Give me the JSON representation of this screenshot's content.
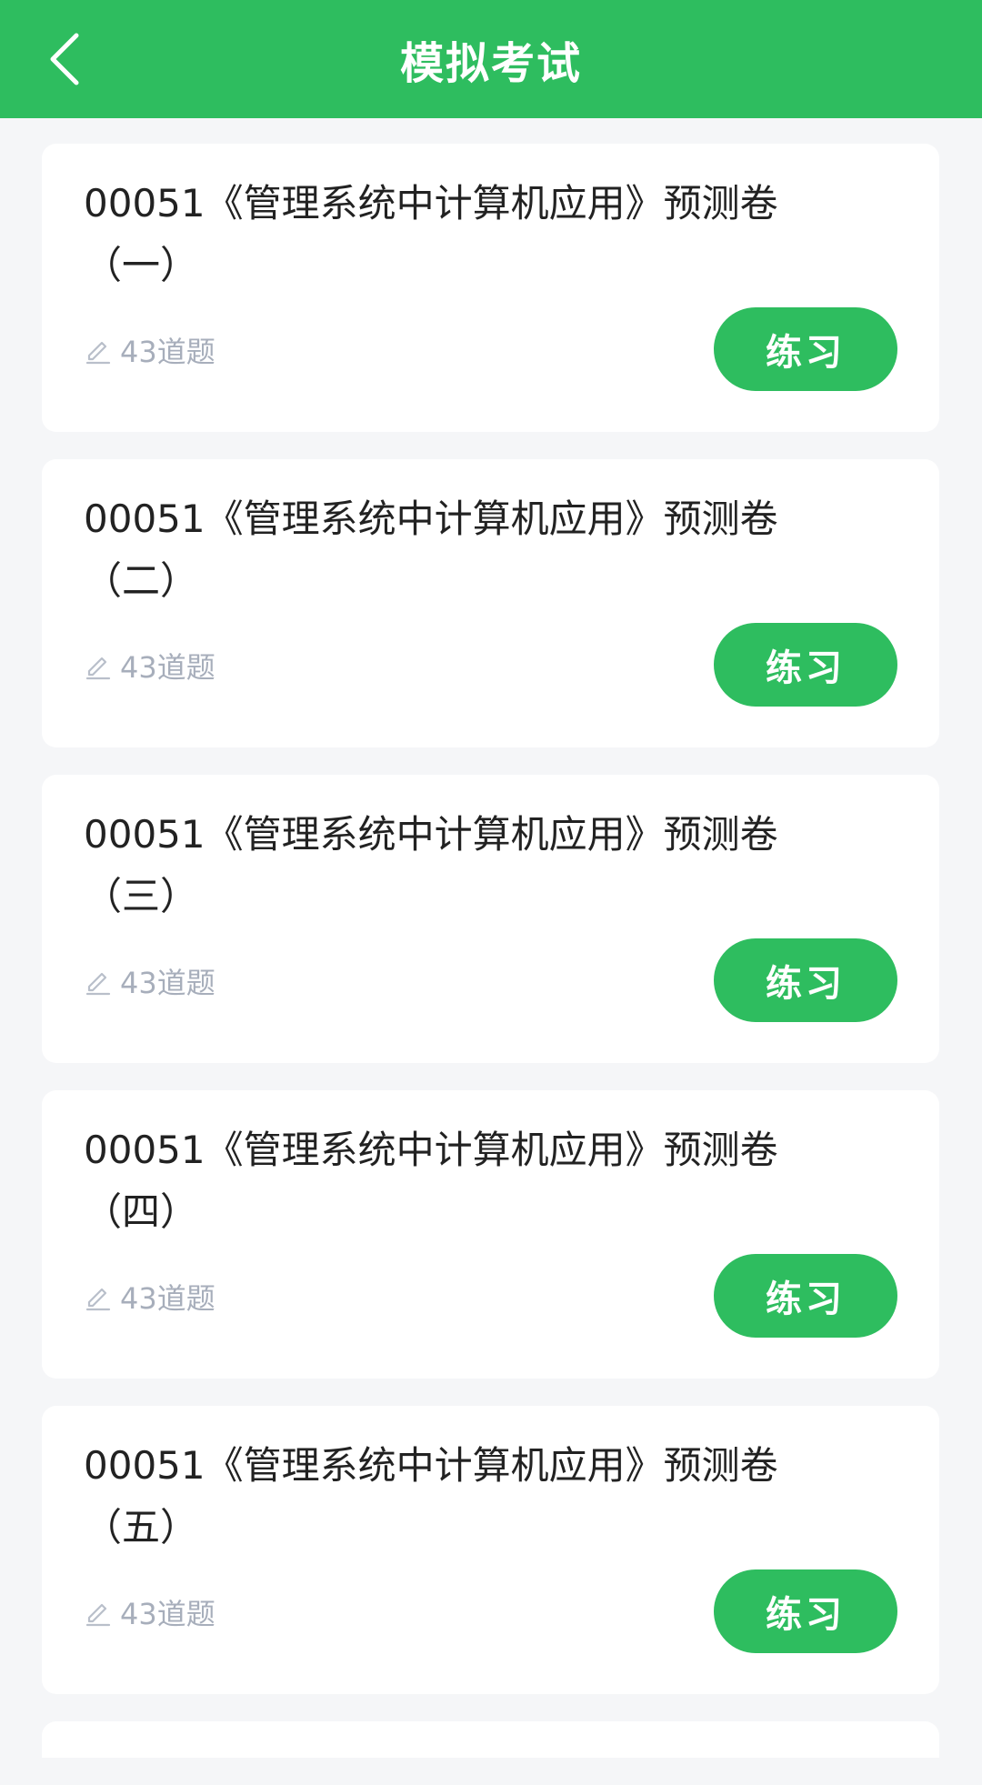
{
  "header": {
    "title": "模拟考试",
    "back_icon": "chevron-left-icon"
  },
  "colors": {
    "brand": "#2ebd5f",
    "background": "#f5f6f8",
    "muted_text": "#a7aebb"
  },
  "papers": [
    {
      "title": "00051《管理系统中计算机应用》预测卷（一）",
      "count": "43道题",
      "button": "练习",
      "icon": "edit-icon"
    },
    {
      "title": "00051《管理系统中计算机应用》预测卷（二）",
      "count": "43道题",
      "button": "练习",
      "icon": "edit-icon"
    },
    {
      "title": "00051《管理系统中计算机应用》预测卷（三）",
      "count": "43道题",
      "button": "练习",
      "icon": "edit-icon"
    },
    {
      "title": "00051《管理系统中计算机应用》预测卷（四）",
      "count": "43道题",
      "button": "练习",
      "icon": "edit-icon"
    },
    {
      "title": "00051《管理系统中计算机应用》预测卷（五）",
      "count": "43道题",
      "button": "练习",
      "icon": "edit-icon"
    }
  ]
}
